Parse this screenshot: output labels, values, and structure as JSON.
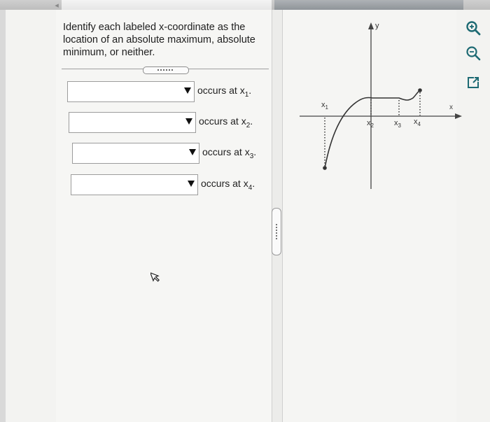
{
  "question": {
    "line1": "Identify each labeled x-coordinate as the",
    "line2": "location of an absolute maximum, absolute",
    "line3": "minimum, or neither."
  },
  "rows": [
    {
      "prefix": "occurs at x",
      "sub": "1",
      "suffix": ".",
      "selected": ""
    },
    {
      "prefix": "occurs at x",
      "sub": "2",
      "suffix": ".",
      "selected": ""
    },
    {
      "prefix": "occurs at x",
      "sub": "3",
      "suffix": ".",
      "selected": ""
    },
    {
      "prefix": "occurs at x",
      "sub": "4",
      "suffix": ".",
      "selected": ""
    }
  ],
  "graph": {
    "y_axis_label": "y",
    "x_axis_label": "x",
    "labels": {
      "x1": "x",
      "x2": "x",
      "x3": "x",
      "x4": "x",
      "s1": "1",
      "s2": "2",
      "s3": "3",
      "s4": "4"
    }
  },
  "icons": [
    "zoom-in-icon",
    "zoom-out-icon",
    "external-link-icon",
    "back-arrow-icon",
    "mouse-cursor-icon"
  ]
}
